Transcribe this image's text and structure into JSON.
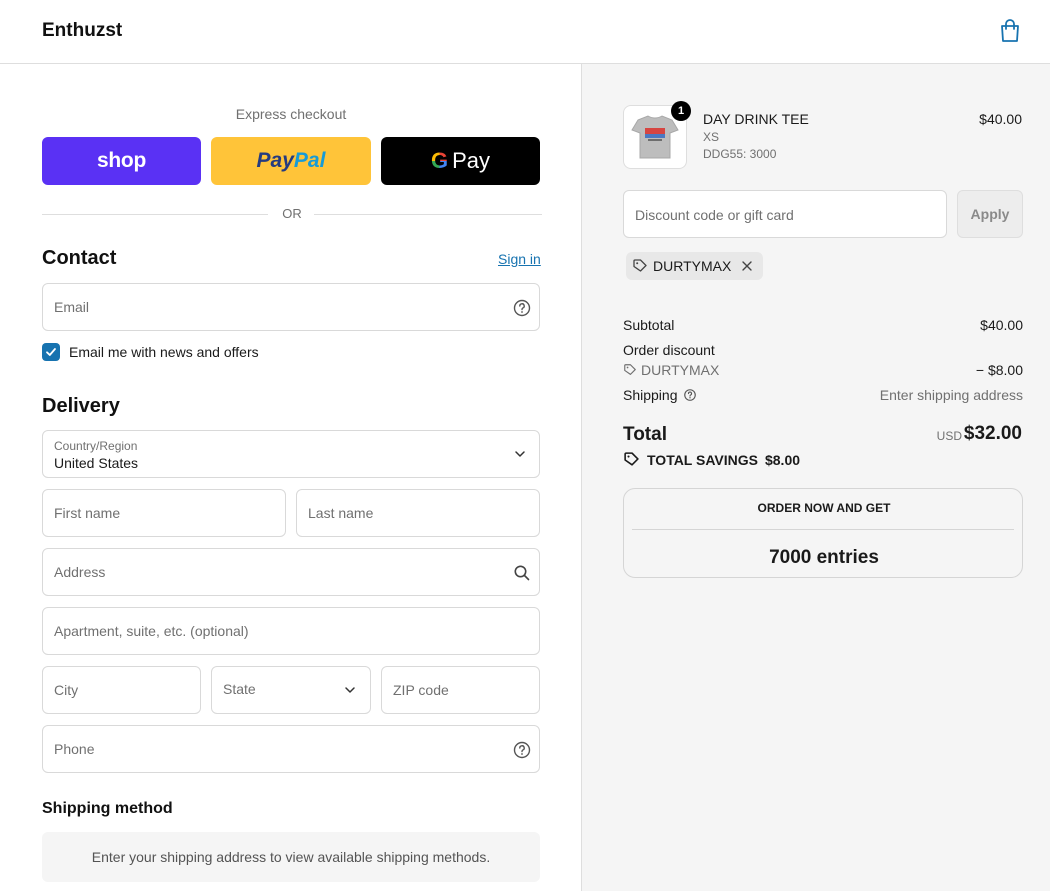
{
  "header": {
    "brand": "Enthuzst",
    "cart_icon": "shopping-bag-icon"
  },
  "express": {
    "label": "Express checkout",
    "shop_label": "shop",
    "paypal_part1": "Pay",
    "paypal_part2": "Pal",
    "gpay_g": "G",
    "gpay_label": "Pay",
    "or_text": "OR"
  },
  "contact": {
    "title": "Contact",
    "sign_in": "Sign in",
    "email_placeholder": "Email",
    "newsletter_label": "Email me with news and offers",
    "newsletter_checked": true
  },
  "delivery": {
    "title": "Delivery",
    "country_label": "Country/Region",
    "country_value": "United States",
    "first_name": "First name",
    "last_name": "Last name",
    "address": "Address",
    "apartment": "Apartment, suite, etc. (optional)",
    "city": "City",
    "state": "State",
    "zip": "ZIP code",
    "phone": "Phone"
  },
  "shipping": {
    "title": "Shipping method",
    "info": "Enter your shipping address to view available shipping methods."
  },
  "cart": {
    "quantity": "1",
    "product_name": "DAY DRINK TEE",
    "variant": "XS",
    "sku": "DDG55: 3000",
    "price": "$40.00"
  },
  "discount": {
    "placeholder": "Discount code or gift card",
    "apply": "Apply",
    "applied_code": "DURTYMAX"
  },
  "summary": {
    "subtotal_label": "Subtotal",
    "subtotal_value": "$40.00",
    "order_discount_label": "Order discount",
    "discount_code": "DURTYMAX",
    "discount_value": "− $8.00",
    "shipping_label": "Shipping",
    "shipping_value": "Enter shipping address",
    "total_label": "Total",
    "currency": "USD",
    "total_value": "$32.00",
    "savings_label": "TOTAL SAVINGS",
    "savings_value": "$8.00"
  },
  "promo": {
    "heading": "ORDER NOW AND GET",
    "entries": "7000 entries"
  },
  "colors": {
    "shop_purple": "#5a31f4",
    "paypal_yellow": "#ffc439",
    "link_blue": "#1773b0"
  }
}
